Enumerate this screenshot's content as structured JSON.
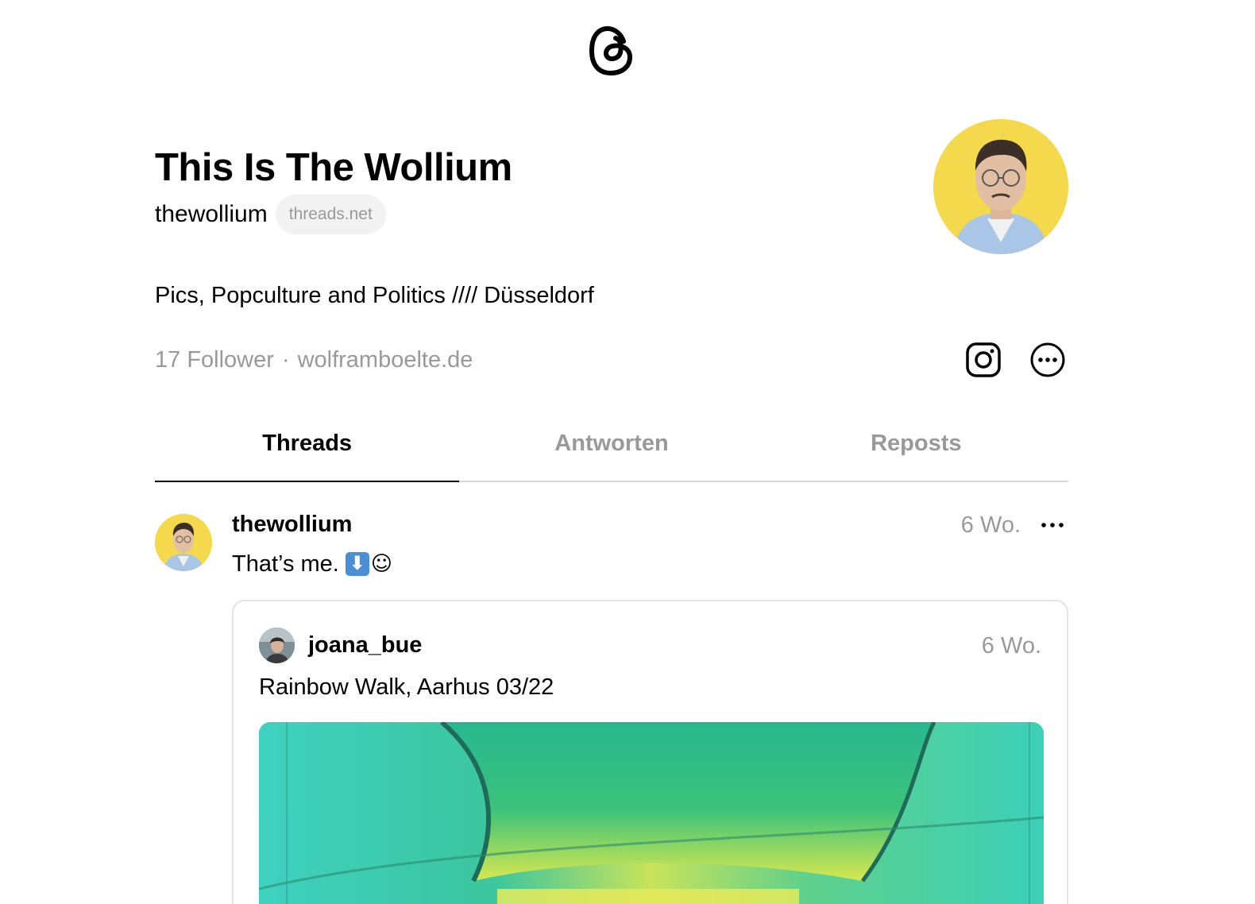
{
  "header": {
    "logo_icon": "threads-logo-icon"
  },
  "profile": {
    "name": "This Is The Wollium",
    "handle": "thewollium",
    "domain_badge": "threads.net",
    "bio": "Pics, Popculture and Politics //// Düsseldorf",
    "followers": "17 Follower",
    "separator": "·",
    "website": "wolframboelte.de",
    "avatar_bg": "#f4d94c"
  },
  "actions": {
    "instagram_icon": "instagram-icon",
    "more_icon": "more-circle-icon"
  },
  "tabs": [
    {
      "label": "Threads",
      "active": true
    },
    {
      "label": "Antworten",
      "active": false
    },
    {
      "label": "Reposts",
      "active": false
    }
  ],
  "post": {
    "author": "thewollium",
    "time": "6 Wo.",
    "text": "That’s me.",
    "emoji_1": "⬇",
    "emoji_2": "☺",
    "quote": {
      "author": "joana_bue",
      "time": "6 Wo.",
      "text": "Rainbow Walk, Aarhus 03/22"
    }
  }
}
